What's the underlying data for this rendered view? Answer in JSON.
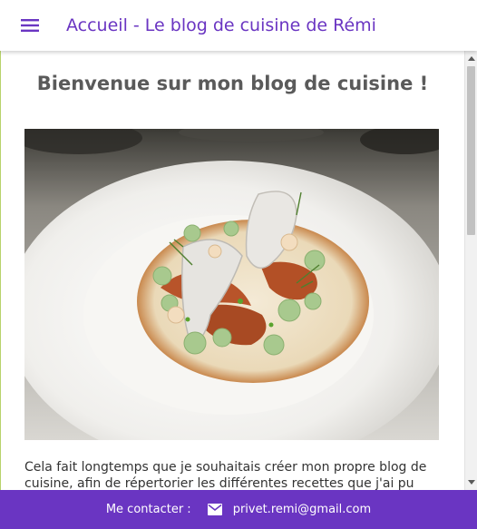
{
  "header": {
    "title": "Accueil - Le blog de cuisine de Rémi",
    "menu_icon": "menu-icon"
  },
  "main": {
    "heading": "Bienvenue sur mon blog de cuisine !",
    "image_icon": "plated-dish-photo",
    "intro_text": "Cela fait longtemps que je souhaitais créer mon propre blog de cuisine, afin de répertorier les différentes recettes que j'ai pu"
  },
  "footer": {
    "contact_label": "Me contacter :",
    "email": "privet.remi@gmail.com",
    "mail_icon": "mail-icon"
  },
  "colors": {
    "accent": "#6a35c2",
    "footer_bg": "#6a35c2",
    "heading_text": "#5a5a5a"
  }
}
